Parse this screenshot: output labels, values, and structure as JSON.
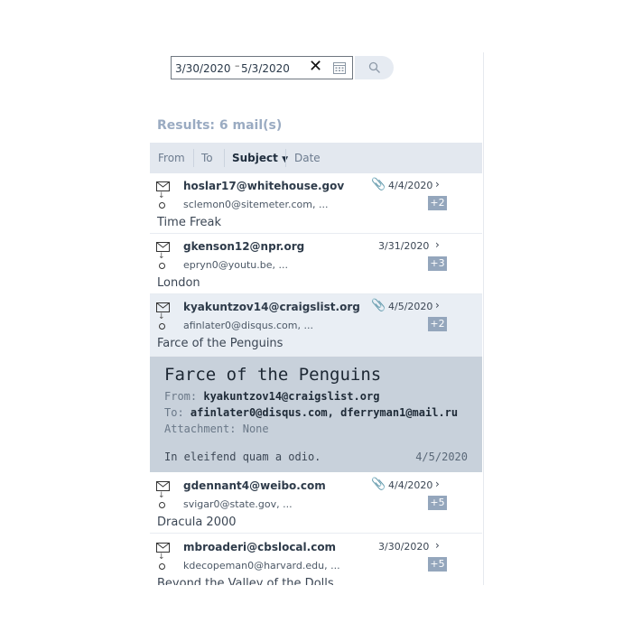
{
  "search": {
    "date_from": "3/30/2020",
    "date_to": "5/3/2020",
    "separator": "–",
    "clear_icon": "close-icon",
    "calendar_icon": "calendar-icon",
    "search_icon": "search-icon"
  },
  "results_label": "Results: 6 mail(s)",
  "columns": [
    {
      "label": "From"
    },
    {
      "label": "To"
    },
    {
      "label": "Subject",
      "sort": "desc"
    },
    {
      "label": "Date"
    }
  ],
  "emails": [
    {
      "from": "hoslar17@whitehouse.gov",
      "to": "sclemon0@sitemeter.com, ...",
      "subject": "Time Freak",
      "date": "4/4/2020",
      "attachment": true,
      "extra": "+2"
    },
    {
      "from": "gkenson12@npr.org",
      "to": "epryn0@youtu.be, ...",
      "subject": "London",
      "date": "3/31/2020",
      "attachment": false,
      "extra": "+3"
    },
    {
      "from": "kyakuntzov14@craigslist.org",
      "to": "afinlater0@disqus.com, ...",
      "subject": "Farce of the Penguins",
      "date": "4/5/2020",
      "attachment": true,
      "extra": "+2",
      "selected": true
    },
    {
      "from": "gdennant4@weibo.com",
      "to": "svigar0@state.gov, ...",
      "subject": "Dracula 2000",
      "date": "4/4/2020",
      "attachment": true,
      "extra": "+5"
    },
    {
      "from": "mbroaderi@cbslocal.com",
      "to": "kdecopeman0@harvard.edu, ...",
      "subject": "Beyond the Valley of the Dolls",
      "date": "3/30/2020",
      "attachment": false,
      "extra": "+5"
    }
  ],
  "preview": {
    "title": "Farce of the Penguins",
    "from_label": "From:",
    "from": "kyakuntzov14@craigslist.org",
    "to_label": "To:",
    "to": "afinlater0@disqus.com, dferryman1@mail.ru",
    "attachment_label": "Attachment:",
    "attachment": "None",
    "body": "In eleifend quam a odio.",
    "date": "4/5/2020"
  },
  "colors": {
    "header_bg": "#e3e8ef",
    "selected_bg": "#e9eef4",
    "preview_bg": "#c8d1db",
    "badge_bg": "#94a6bc",
    "results_text": "#9aabc2"
  }
}
